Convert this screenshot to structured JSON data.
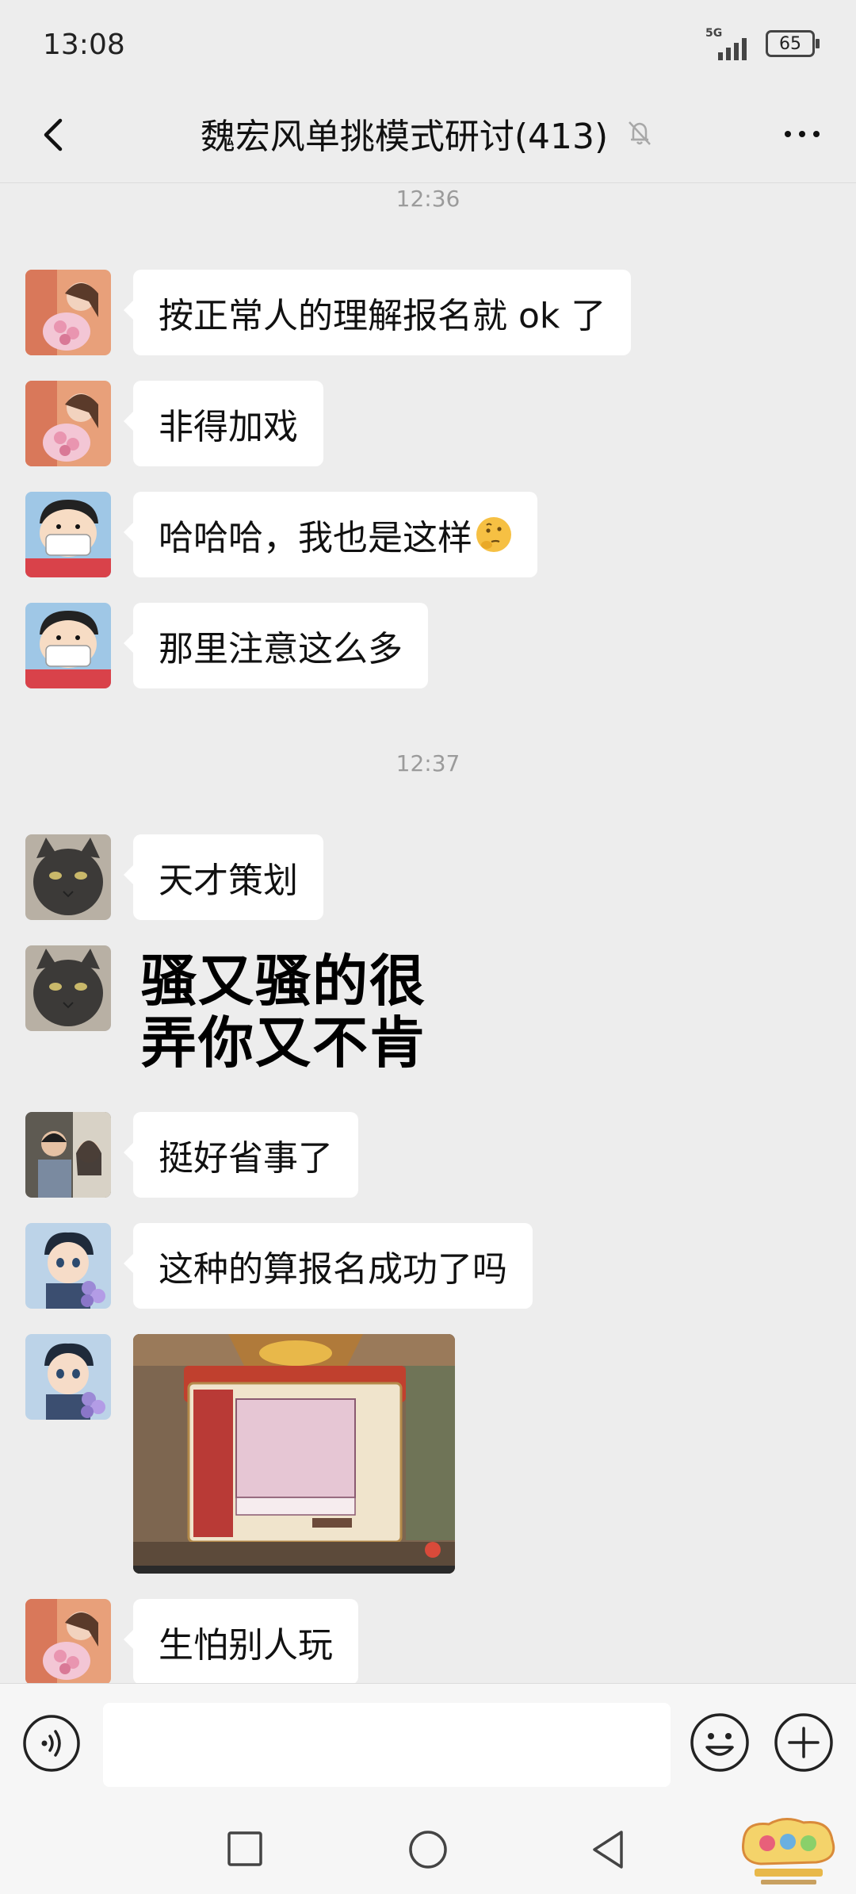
{
  "status_bar": {
    "time": "13:08",
    "network": "5G",
    "battery": "65"
  },
  "header": {
    "title": "魏宏风单挑模式研讨(413)",
    "back_icon": "chevron-left-icon",
    "mute_icon": "bell-off-icon",
    "more_icon": "ellipsis-icon"
  },
  "chat": {
    "timestamps": [
      "12:36",
      "12:37"
    ],
    "messages": [
      {
        "text": "按正常人的理解报名就 ok 了"
      },
      {
        "text": "非得加戏"
      },
      {
        "text": "哈哈哈，我也是这样",
        "emoji": "thinking-face-emoji"
      },
      {
        "text": "那里注意这么多"
      },
      {
        "text": "天才策划"
      },
      {
        "sticker_line1": "骚又骚的很",
        "sticker_line2": "弄你又不肯"
      },
      {
        "text": "挺好省事了"
      },
      {
        "text": "这种的算报名成功了吗"
      },
      {
        "image": "game-screenshot"
      },
      {
        "text": "生怕别人玩"
      }
    ]
  },
  "input_bar": {
    "placeholder": "",
    "voice_icon": "voice-icon",
    "emoji_icon": "smiley-icon",
    "plus_icon": "plus-icon"
  },
  "colors": {
    "background": "#ededed",
    "bubble": "#ffffff",
    "timestamp": "#9b9b9b"
  }
}
